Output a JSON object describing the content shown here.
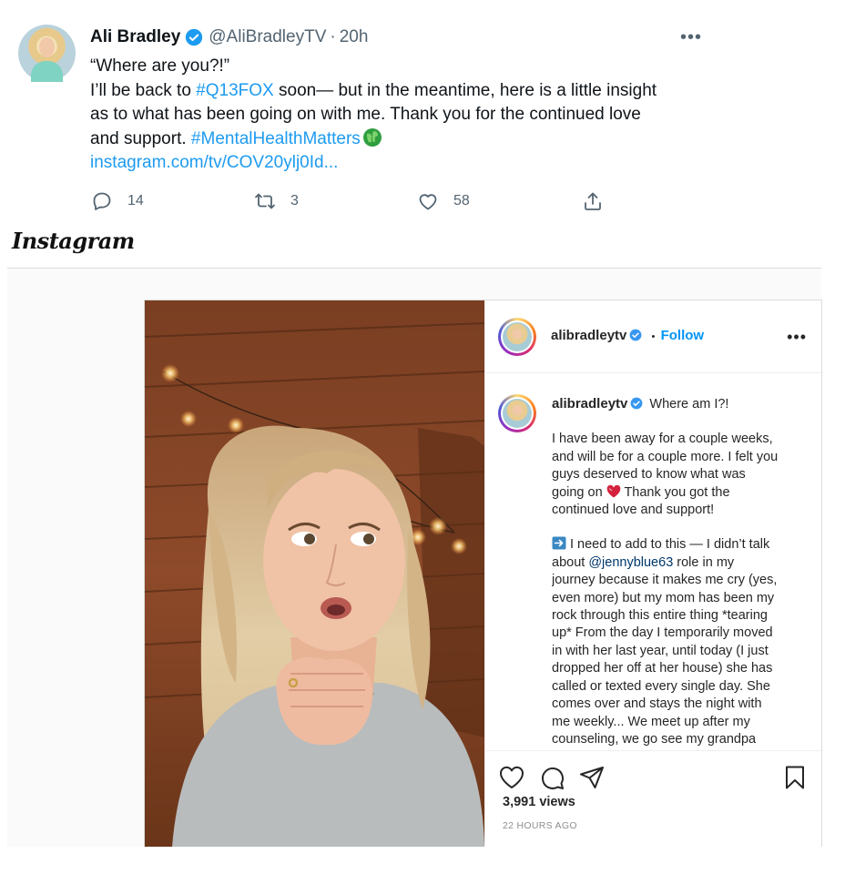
{
  "tweet": {
    "author_name": "Ali Bradley",
    "handle": "@AliBradleyTV",
    "separator": "·",
    "time": "20h",
    "more": "•••",
    "text": {
      "line1": "“Where are you?!”",
      "line2_prefix": "I’ll be back to ",
      "line2_hashtag": "#Q13FOX",
      "line2_suffix": " soon— but in the meantime, here is a little insight",
      "line3": "as to what has been going on with me. Thank you for the continued love",
      "line4_prefix": "and support. ",
      "line4_hashtag": "#MentalHealthMatters",
      "link": "instagram.com/tv/COV20ylj0Id..."
    },
    "actions": {
      "replies": "14",
      "retweets": "3",
      "likes": "58"
    }
  },
  "instagram": {
    "brand": "Instagram",
    "username": "alibradleytv",
    "follow_sep": "•",
    "follow_label": "Follow",
    "more": "•••",
    "caption": {
      "title": "Where am I?!",
      "p1": [
        "I have been away for a couple weeks,",
        "and will be for a couple more. I felt you",
        "guys deserved to know what was"
      ],
      "p1_line4_prefix": "going on ",
      "p1_line4_suffix": " Thank you got the",
      "p1_line5": "continued love and support!",
      "p2_line1": "I need to add to this — I didn’t talk",
      "p2_line2_prefix": "about ",
      "p2_mention": "@jennyblue63",
      "p2_line2_suffix": " role in my",
      "p2_rest": [
        "journey because it makes me cry (yes,",
        "even more) but my mom has been my",
        "rock through this entire thing *tearing",
        "up* From the day I temporarily moved",
        "in with her last year, until today (I just",
        "dropped her off at her house) she has",
        "called or texted every single day. She",
        "comes over and stays the night with",
        "me weekly... We meet up after my",
        "counseling, we go see my grandpa"
      ]
    },
    "views": "3,991 views",
    "time_ago": "22 HOURS AGO"
  },
  "colors": {
    "twitter_link": "#1d9bf0",
    "ig_follow": "#0095f6",
    "muted": "#536471"
  }
}
